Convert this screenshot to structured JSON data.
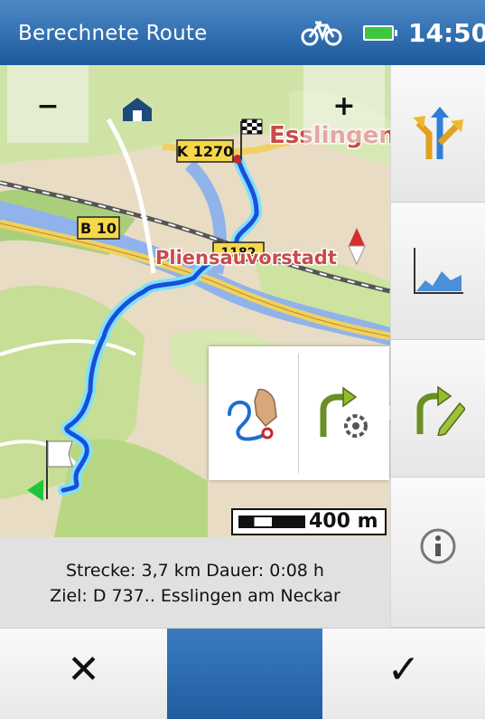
{
  "statusbar": {
    "title": "Berechnete Route",
    "time": "14:50",
    "icons": [
      "bicycle-icon",
      "battery-icon"
    ],
    "battery_color": "#3fc63f"
  },
  "map": {
    "zoom_out_label": "−",
    "zoom_in_label": "+",
    "road_labels": {
      "k1270": "K 1270",
      "b10": "B 10",
      "partial": "1182"
    },
    "place_labels": {
      "esslingen": "Esslingen",
      "pliensau": "Pliensauvorstadt"
    },
    "scale_label": "400 m",
    "route_color": "#1a4fd8",
    "route_glow": "#4fd2ff"
  },
  "route_info": {
    "line1": "Strecke: 3,7 km Dauer: 0:08 h",
    "line2": "Ziel: D 737.. Esslingen am Neckar"
  },
  "sidebar": {
    "items": [
      {
        "icon": "route-options-icon"
      },
      {
        "icon": "elevation-profile-icon"
      },
      {
        "icon": "edit-route-icon"
      },
      {
        "icon": "info-icon"
      }
    ]
  },
  "popup": {
    "items": [
      {
        "icon": "draw-route-icon"
      },
      {
        "icon": "route-settings-icon"
      }
    ]
  },
  "bottom": {
    "cancel_label": "✕",
    "confirm_label": "✓",
    "middle_color": "#1f5d9f"
  }
}
